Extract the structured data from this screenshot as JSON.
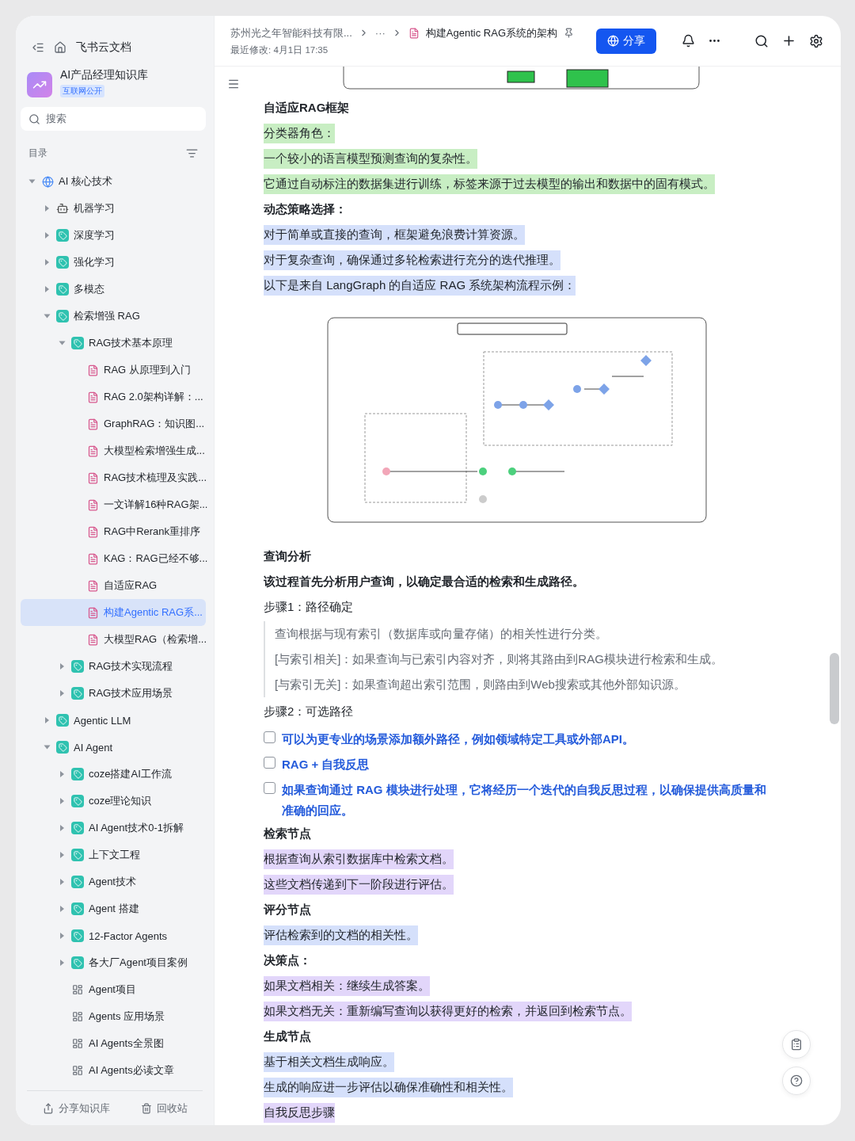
{
  "sidebar": {
    "home_title": "飞书云文档",
    "space": {
      "name": "AI产品经理知识库",
      "badge": "互联网公开"
    },
    "search": {
      "placeholder": "搜索"
    },
    "toc_label": "目录",
    "tree": [
      {
        "label": "AI 核心技术",
        "kind": "globe",
        "expanded": true,
        "selected": false,
        "children": [
          {
            "label": "机器学习",
            "kind": "robot",
            "expanded": false,
            "selected": false
          },
          {
            "label": "深度学习",
            "kind": "tag",
            "expanded": false,
            "selected": false
          },
          {
            "label": "强化学习",
            "kind": "tag",
            "expanded": false,
            "selected": false
          },
          {
            "label": "多模态",
            "kind": "tag",
            "expanded": false,
            "selected": false
          },
          {
            "label": "检索增强 RAG",
            "kind": "tag",
            "expanded": true,
            "selected": false,
            "children": [
              {
                "label": "RAG技术基本原理",
                "kind": "tag",
                "expanded": true,
                "selected": false,
                "children": [
                  {
                    "label": "RAG 从原理到入门",
                    "kind": "doc",
                    "selected": false
                  },
                  {
                    "label": "RAG 2.0架构详解：...",
                    "kind": "doc",
                    "selected": false
                  },
                  {
                    "label": "GraphRAG：知识图...",
                    "kind": "doc",
                    "selected": false
                  },
                  {
                    "label": "大模型检索增强生成...",
                    "kind": "doc",
                    "selected": false
                  },
                  {
                    "label": "RAG技术梳理及实践...",
                    "kind": "doc",
                    "selected": false
                  },
                  {
                    "label": "一文详解16种RAG架...",
                    "kind": "doc",
                    "selected": false
                  },
                  {
                    "label": "RAG中Rerank重排序",
                    "kind": "doc",
                    "selected": false
                  },
                  {
                    "label": "KAG：RAG已经不够...",
                    "kind": "doc",
                    "selected": false
                  },
                  {
                    "label": "自适应RAG",
                    "kind": "doc",
                    "selected": false
                  },
                  {
                    "label": "构建Agentic RAG系...",
                    "kind": "doc",
                    "selected": true
                  },
                  {
                    "label": "大模型RAG（检索增...",
                    "kind": "doc",
                    "selected": false
                  }
                ]
              },
              {
                "label": "RAG技术实现流程",
                "kind": "tag",
                "expanded": false,
                "selected": false
              },
              {
                "label": "RAG技术应用场景",
                "kind": "tag",
                "expanded": false,
                "selected": false
              }
            ]
          },
          {
            "label": "Agentic LLM",
            "kind": "tag",
            "expanded": false,
            "selected": false
          },
          {
            "label": "AI Agent",
            "kind": "tag",
            "expanded": true,
            "selected": false,
            "children": [
              {
                "label": "coze搭建AI工作流",
                "kind": "tag",
                "expanded": false,
                "selected": false
              },
              {
                "label": "coze理论知识",
                "kind": "tag",
                "expanded": false,
                "selected": false
              },
              {
                "label": "AI Agent技术0-1拆解",
                "kind": "tag",
                "expanded": false,
                "selected": false
              },
              {
                "label": "上下文工程",
                "kind": "tag",
                "expanded": false,
                "selected": false
              },
              {
                "label": "Agent技术",
                "kind": "tag",
                "expanded": false,
                "selected": false
              },
              {
                "label": "Agent 搭建",
                "kind": "tag",
                "expanded": false,
                "selected": false
              },
              {
                "label": "12-Factor Agents",
                "kind": "tag",
                "expanded": false,
                "selected": false
              },
              {
                "label": "各大厂Agent项目案例",
                "kind": "tag",
                "expanded": false,
                "selected": false
              },
              {
                "label": "Agent项目",
                "kind": "board",
                "selected": false
              },
              {
                "label": "Agents 应用场景",
                "kind": "board",
                "selected": false
              },
              {
                "label": "AI Agents全景图",
                "kind": "board",
                "selected": false
              },
              {
                "label": "AI Agents必读文章",
                "kind": "board",
                "selected": false
              }
            ]
          }
        ]
      }
    ],
    "footer": [
      "分享知识库",
      "回收站"
    ]
  },
  "header": {
    "breadcrumb": [
      "苏州光之年智能科技有限...",
      "···"
    ],
    "title": "构建Agentic RAG系统的架构",
    "modified": "最近修改: 4月1日 17:35",
    "share": "分享"
  },
  "blocks": [
    {
      "kind": "figure-bottom"
    },
    {
      "kind": "heading",
      "text": "自适应RAG框架"
    },
    {
      "kind": "highlight",
      "text": "分类器角色：",
      "color": "#c8eec3"
    },
    {
      "kind": "highlight",
      "text": "一个较小的语言模型预测查询的复杂性。",
      "color": "#c8eec3"
    },
    {
      "kind": "highlight",
      "text": "它通过自动标注的数据集进行训练，标签来源于过去模型的输出和数据中的固有模式。",
      "color": "#c8eec3"
    },
    {
      "kind": "heading",
      "text": "动态策略选择："
    },
    {
      "kind": "highlight",
      "text": "对于简单或直接的查询，框架避免浪费计算资源。",
      "color": "#d5e0fb"
    },
    {
      "kind": "highlight",
      "text": "对于复杂查询，确保通过多轮检索进行充分的迭代推理。",
      "color": "#d5e0fb"
    },
    {
      "kind": "highlight",
      "text": "以下是来自 LangGraph 的自适应 RAG 系统架构流程示例：",
      "color": "#d5e0fb"
    },
    {
      "kind": "figure"
    },
    {
      "kind": "heading",
      "text": "查询分析"
    },
    {
      "kind": "heading",
      "text": "该过程首先分析用户查询，以确定最合适的检索和生成路径。"
    },
    {
      "kind": "para",
      "text": "步骤1：路径确定"
    },
    {
      "kind": "quote",
      "lines": [
        "查询根据与现有索引（数据库或向量存储）的相关性进行分类。",
        "[与索引相关]：如果查询与已索引内容对齐，则将其路由到RAG模块进行检索和生成。",
        "[与索引无关]：如果查询超出索引范围，则路由到Web搜索或其他外部知识源。"
      ]
    },
    {
      "kind": "para",
      "text": "步骤2：可选路径"
    },
    {
      "kind": "check",
      "text": "可以为更专业的场景添加额外路径，例如领域特定工具或外部API。",
      "checked": false
    },
    {
      "kind": "check",
      "text": "RAG + 自我反思",
      "checked": false
    },
    {
      "kind": "check",
      "text": "如果查询通过 RAG 模块进行处理，它将经历一个迭代的自我反思过程，以确保提供高质量和准确的回应。",
      "checked": false
    },
    {
      "kind": "heading",
      "text": "检索节点"
    },
    {
      "kind": "highlight",
      "text": "根据查询从索引数据库中检索文档。",
      "color": "#e2d6fa"
    },
    {
      "kind": "highlight",
      "text": "这些文档传递到下一阶段进行评估。",
      "color": "#e2d6fa"
    },
    {
      "kind": "heading",
      "text": "评分节点"
    },
    {
      "kind": "highlight",
      "text": "评估检索到的文档的相关性。",
      "color": "#d5e0fb"
    },
    {
      "kind": "heading",
      "text": "决策点："
    },
    {
      "kind": "highlight",
      "text": "如果文档相关：继续生成答案。",
      "color": "#e2d6fa"
    },
    {
      "kind": "highlight",
      "text": "如果文档无关：重新编写查询以获得更好的检索，并返回到检索节点。",
      "color": "#e2d6fa"
    },
    {
      "kind": "heading",
      "text": "生成节点"
    },
    {
      "kind": "highlight",
      "text": "基于相关文档生成响应。",
      "color": "#d5e0fb"
    },
    {
      "kind": "highlight",
      "text": "生成的响应进一步评估以确保准确性和相关性。",
      "color": "#d5e0fb"
    },
    {
      "kind": "highlight",
      "text": "自我反思步骤",
      "color": "#e2d6fa"
    }
  ]
}
